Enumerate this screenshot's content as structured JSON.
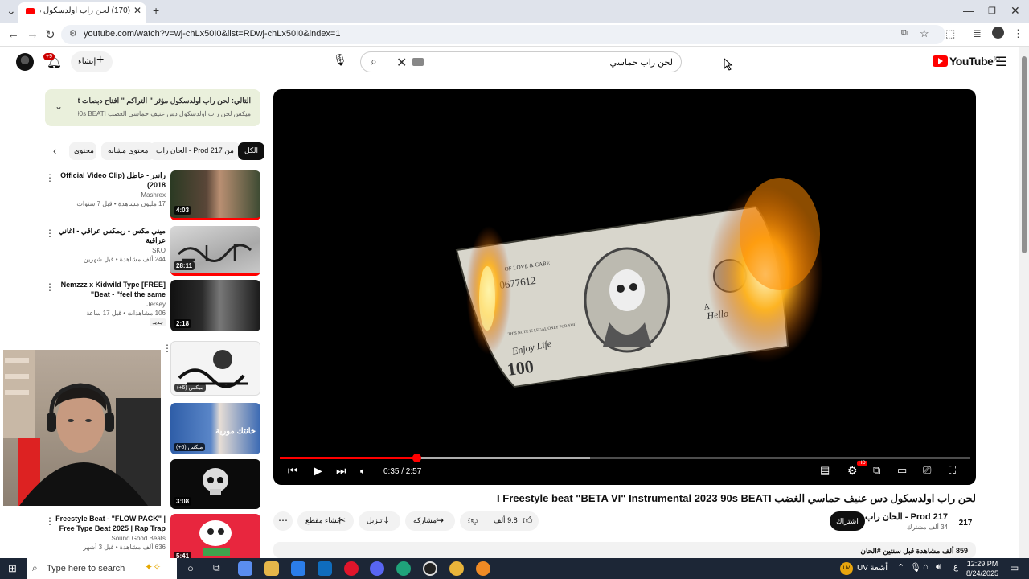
{
  "browser": {
    "tab_title": "(170) لحن راب اولدسكول دس عنيف",
    "url": "youtube.com/watch?v=wj-chLx50I0&list=RDwj-chLx50I0&index=1"
  },
  "header": {
    "search_query": "لحن راب حماسي",
    "create_label": "إنشاء",
    "notif_count": "+9",
    "logo_text": "YouTube",
    "logo_region": "JO"
  },
  "up_next": {
    "line1": "التالي: لحن راب اولدسكول مؤثر \" التراكم \" افتاح دبصات type beat",
    "line2": "ميكس لحن راب اولدسكول دس عنيف حماسي الغضب I Freestyle beat BETA VI Instrumental 2023 90s BEATI"
  },
  "chips": {
    "all": "الكل",
    "from": "من 217 Prod - الحان راب",
    "related": "محتوى مشابه",
    "more": "محتوى"
  },
  "recommendations": [
    {
      "title": "راندر - عاطل (Official Video Clip 2018)",
      "channel": "Mashrex",
      "stats": "17 مليون مشاهدة • قبل 7 سنوات",
      "duration": "4:03"
    },
    {
      "title": "ميني مكس - ريمكس عراقي - اغاني عراقية",
      "channel": "SKO",
      "stats": "244 ألف مشاهدة • قبل شهرين",
      "duration": "28:11"
    },
    {
      "title": "[FREE] Nemzzz x Kidwild Type Beat - \"feel the same\"",
      "channel": "Jersey",
      "stats": "106 مشاهدات • قبل 17 ساعة",
      "badge": "جديد",
      "duration": "2:18"
    },
    {
      "mix_label": "(+6) ميكس"
    },
    {
      "mix_label": "(+6) ميكس",
      "thumb_text": "خانتك مورية"
    },
    {
      "duration": "3:08"
    },
    {
      "title": "Freestyle Beat - \"FLOW PACK\" | Free Type Beat 2025 | Rap Trap",
      "channel": "Sound Good Beats",
      "stats": "636 ألف مشاهدة • قبل 3 أشهر",
      "duration": "5:41"
    }
  ],
  "player": {
    "time_current": "0:35",
    "time_total": "2:57",
    "time_display": "0:35 / 2:57",
    "progress_played": 0.198,
    "progress_buffered": 0.45,
    "hd_badge": "HD"
  },
  "video": {
    "title": "لحن راب اولدسكول دس عنيف حماسي الغضب I Freestyle beat \"BETA VI\" Instrumental 2023 90s BEATI",
    "channel": "217 Prod - الحان راب",
    "channel_logo": "217",
    "subscribers": "34 ألف مشترك",
    "subscribe_label": "اشتراك",
    "likes": "9.8 ألف",
    "share_label": "مشاركة",
    "download_label": "تنزيل",
    "clip_label": "إنشاء مقطع",
    "description": "859 ألف مشاهدة  قبل سنتين  #الحان"
  },
  "banknote": {
    "serial": "0677612",
    "legend": "OF LOVE & CARE",
    "tender": "THIS NOTE IS LEGAL ONLY FOR YOU",
    "motto": "Enjoy Life",
    "denomination": "100",
    "hello": "Hello",
    "letter": "A"
  },
  "taskbar": {
    "search_placeholder": "Type here to search",
    "weather": "أشعة UV",
    "weather_badge": "UV",
    "lang": "ع",
    "time": "12:29 PM",
    "date": "8/24/2025"
  },
  "colors": {
    "accent": "#ff0000",
    "dark": "#0f0f0f",
    "chip_bg": "#f2f2f2",
    "next_bg": "#eaf0dc",
    "taskbar": "#1c2636"
  }
}
